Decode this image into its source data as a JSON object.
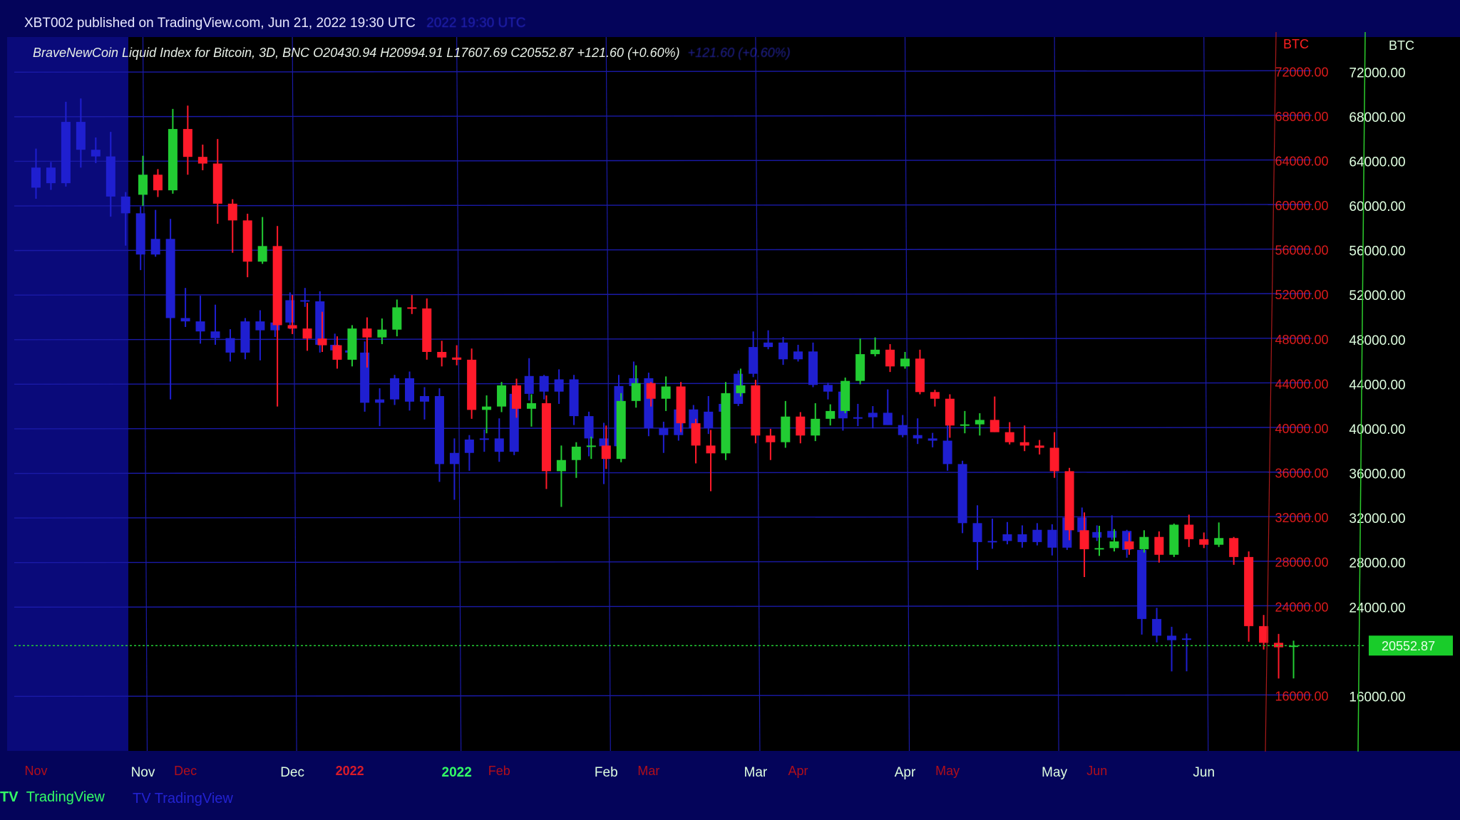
{
  "header": {
    "publish_line": "XBT002 published on TradingView.com, Jun 21, 2022 19:30 UTC",
    "ghost_publish_time": "2022 19:30 UTC",
    "symbol_line": "BraveNewCoin Liquid Index for Bitcoin, 3D, BNC  O20430.94  H20994.91  L17607.69  C20552.87  +121.60 (+0.60%)",
    "ghost_change": "+121.60 (+0.60%)"
  },
  "footer": {
    "brand": "TradingView",
    "logo": "TV"
  },
  "colors": {
    "background": "#000000",
    "frame": "#04045a",
    "up": "#22cc33",
    "down": "#ff1a2a",
    "ghost": "#1f1fd0",
    "grid": "#1a1aa8",
    "axis_text_green": "#dfffe0",
    "axis_text_red": "#ff2020",
    "last_price_bg": "#19cc2a"
  },
  "chart_data": {
    "type": "candlestick",
    "title": "BraveNewCoin Liquid Index for Bitcoin, 3D, BNC",
    "ylabel": "BTC",
    "ylim": [
      12000,
      74000
    ],
    "y_ticks": [
      "72000.00",
      "68000.00",
      "64000.00",
      "60000.00",
      "56000.00",
      "52000.00",
      "48000.00",
      "44000.00",
      "40000.00",
      "36000.00",
      "32000.00",
      "28000.00",
      "24000.00",
      "16000.00"
    ],
    "x_ticks": [
      "Nov",
      "Dec",
      "2022",
      "Feb",
      "Mar",
      "Apr",
      "May",
      "Jun"
    ],
    "last_price": "20552.87",
    "last_candle": {
      "open": 20430.94,
      "high": 20994.91,
      "low": 17607.69,
      "close": 20552.87,
      "change": "+121.60 (+0.60%)"
    },
    "candles": [
      {
        "date": "2021-11-01",
        "o": 61000,
        "h": 64500,
        "l": 60000,
        "c": 62800
      },
      {
        "date": "2021-11-04",
        "o": 62800,
        "h": 63300,
        "l": 60800,
        "c": 61400
      },
      {
        "date": "2021-11-07",
        "o": 61400,
        "h": 68700,
        "l": 61100,
        "c": 66900
      },
      {
        "date": "2021-11-10",
        "o": 66900,
        "h": 69000,
        "l": 62800,
        "c": 64400
      },
      {
        "date": "2021-11-13",
        "o": 64400,
        "h": 65500,
        "l": 63200,
        "c": 63800
      },
      {
        "date": "2021-11-16",
        "o": 63800,
        "h": 66000,
        "l": 58400,
        "c": 60200
      },
      {
        "date": "2021-11-19",
        "o": 60200,
        "h": 60600,
        "l": 55800,
        "c": 58700
      },
      {
        "date": "2021-11-22",
        "o": 58700,
        "h": 59300,
        "l": 53600,
        "c": 55000
      },
      {
        "date": "2021-11-25",
        "o": 55000,
        "h": 59000,
        "l": 54800,
        "c": 56400
      },
      {
        "date": "2021-11-28",
        "o": 56400,
        "h": 58200,
        "l": 42000,
        "c": 49300
      },
      {
        "date": "2021-12-01",
        "o": 49300,
        "h": 52000,
        "l": 48500,
        "c": 49000
      },
      {
        "date": "2021-12-04",
        "o": 49000,
        "h": 51300,
        "l": 47000,
        "c": 48100
      },
      {
        "date": "2021-12-07",
        "o": 48100,
        "h": 50500,
        "l": 46900,
        "c": 47500
      },
      {
        "date": "2021-12-10",
        "o": 47500,
        "h": 48300,
        "l": 45400,
        "c": 46200
      },
      {
        "date": "2021-12-13",
        "o": 46200,
        "h": 49300,
        "l": 45600,
        "c": 49000
      },
      {
        "date": "2021-12-16",
        "o": 49000,
        "h": 50000,
        "l": 45500,
        "c": 48200
      },
      {
        "date": "2021-12-19",
        "o": 48200,
        "h": 49900,
        "l": 47600,
        "c": 48900
      },
      {
        "date": "2021-12-22",
        "o": 48900,
        "h": 51600,
        "l": 48300,
        "c": 50900
      },
      {
        "date": "2021-12-25",
        "o": 50900,
        "h": 52000,
        "l": 50300,
        "c": 50800
      },
      {
        "date": "2021-12-28",
        "o": 50800,
        "h": 51700,
        "l": 46200,
        "c": 46900
      },
      {
        "date": "2021-12-31",
        "o": 46900,
        "h": 47900,
        "l": 45600,
        "c": 46400
      },
      {
        "date": "2022-01-03",
        "o": 46400,
        "h": 47500,
        "l": 45700,
        "c": 46200
      },
      {
        "date": "2022-01-06",
        "o": 46200,
        "h": 47200,
        "l": 40900,
        "c": 41700
      },
      {
        "date": "2022-01-09",
        "o": 41700,
        "h": 43000,
        "l": 39600,
        "c": 42000
      },
      {
        "date": "2022-01-12",
        "o": 42000,
        "h": 44200,
        "l": 41500,
        "c": 43900
      },
      {
        "date": "2022-01-15",
        "o": 43900,
        "h": 44500,
        "l": 41000,
        "c": 41800
      },
      {
        "date": "2022-01-18",
        "o": 41800,
        "h": 43100,
        "l": 40200,
        "c": 42300
      },
      {
        "date": "2022-01-21",
        "o": 42300,
        "h": 43000,
        "l": 34600,
        "c": 36200
      },
      {
        "date": "2022-01-24",
        "o": 36200,
        "h": 38500,
        "l": 33000,
        "c": 37200
      },
      {
        "date": "2022-01-27",
        "o": 37200,
        "h": 38800,
        "l": 35600,
        "c": 38400
      },
      {
        "date": "2022-01-30",
        "o": 38400,
        "h": 39300,
        "l": 37300,
        "c": 38500
      },
      {
        "date": "2022-02-02",
        "o": 38500,
        "h": 40300,
        "l": 36400,
        "c": 37300
      },
      {
        "date": "2022-02-05",
        "o": 37300,
        "h": 43200,
        "l": 37000,
        "c": 42500
      },
      {
        "date": "2022-02-08",
        "o": 42500,
        "h": 45700,
        "l": 41900,
        "c": 44100
      },
      {
        "date": "2022-02-11",
        "o": 44100,
        "h": 44200,
        "l": 42000,
        "c": 42700
      },
      {
        "date": "2022-02-14",
        "o": 42700,
        "h": 44700,
        "l": 41600,
        "c": 43800
      },
      {
        "date": "2022-02-17",
        "o": 43800,
        "h": 44200,
        "l": 39700,
        "c": 40500
      },
      {
        "date": "2022-02-20",
        "o": 40500,
        "h": 40900,
        "l": 36900,
        "c": 38500
      },
      {
        "date": "2022-02-23",
        "o": 38500,
        "h": 39900,
        "l": 34400,
        "c": 37800
      },
      {
        "date": "2022-02-26",
        "o": 37800,
        "h": 44200,
        "l": 37200,
        "c": 43200
      },
      {
        "date": "2022-03-01",
        "o": 43200,
        "h": 45400,
        "l": 42900,
        "c": 43900
      },
      {
        "date": "2022-03-04",
        "o": 43900,
        "h": 44400,
        "l": 38700,
        "c": 39400
      },
      {
        "date": "2022-03-07",
        "o": 39400,
        "h": 40000,
        "l": 37200,
        "c": 38800
      },
      {
        "date": "2022-03-10",
        "o": 38800,
        "h": 42500,
        "l": 38300,
        "c": 41100
      },
      {
        "date": "2022-03-13",
        "o": 41100,
        "h": 41500,
        "l": 38700,
        "c": 39400
      },
      {
        "date": "2022-03-16",
        "o": 39400,
        "h": 42300,
        "l": 38900,
        "c": 40900
      },
      {
        "date": "2022-03-19",
        "o": 40900,
        "h": 42200,
        "l": 40300,
        "c": 41600
      },
      {
        "date": "2022-03-22",
        "o": 41600,
        "h": 44600,
        "l": 41400,
        "c": 44300
      },
      {
        "date": "2022-03-25",
        "o": 44300,
        "h": 48100,
        "l": 44000,
        "c": 46700
      },
      {
        "date": "2022-03-28",
        "o": 46700,
        "h": 48200,
        "l": 46500,
        "c": 47100
      },
      {
        "date": "2022-03-31",
        "o": 47100,
        "h": 47600,
        "l": 45100,
        "c": 45600
      },
      {
        "date": "2022-04-03",
        "o": 45600,
        "h": 46900,
        "l": 45400,
        "c": 46300
      },
      {
        "date": "2022-04-06",
        "o": 46300,
        "h": 47100,
        "l": 43100,
        "c": 43300
      },
      {
        "date": "2022-04-09",
        "o": 43300,
        "h": 43500,
        "l": 42000,
        "c": 42700
      },
      {
        "date": "2022-04-12",
        "o": 42700,
        "h": 43100,
        "l": 39200,
        "c": 40300
      },
      {
        "date": "2022-04-15",
        "o": 40300,
        "h": 41600,
        "l": 39600,
        "c": 40400
      },
      {
        "date": "2022-04-18",
        "o": 40400,
        "h": 41400,
        "l": 39400,
        "c": 40800
      },
      {
        "date": "2022-04-21",
        "o": 40800,
        "h": 42900,
        "l": 39700,
        "c": 39700
      },
      {
        "date": "2022-04-24",
        "o": 39700,
        "h": 40600,
        "l": 38600,
        "c": 38800
      },
      {
        "date": "2022-04-27",
        "o": 38800,
        "h": 40300,
        "l": 38000,
        "c": 38500
      },
      {
        "date": "2022-04-30",
        "o": 38500,
        "h": 39000,
        "l": 37700,
        "c": 38300
      },
      {
        "date": "2022-05-03",
        "o": 38300,
        "h": 39700,
        "l": 35600,
        "c": 36200
      },
      {
        "date": "2022-05-06",
        "o": 36200,
        "h": 36500,
        "l": 30000,
        "c": 30900
      },
      {
        "date": "2022-05-09",
        "o": 30900,
        "h": 32500,
        "l": 26700,
        "c": 29200
      },
      {
        "date": "2022-05-12",
        "o": 29200,
        "h": 31300,
        "l": 28600,
        "c": 29300
      },
      {
        "date": "2022-05-15",
        "o": 29300,
        "h": 31000,
        "l": 29000,
        "c": 29900
      },
      {
        "date": "2022-05-18",
        "o": 29900,
        "h": 30700,
        "l": 28700,
        "c": 29200
      },
      {
        "date": "2022-05-21",
        "o": 29200,
        "h": 30900,
        "l": 28900,
        "c": 30300
      },
      {
        "date": "2022-05-24",
        "o": 30300,
        "h": 30800,
        "l": 28000,
        "c": 28700
      },
      {
        "date": "2022-05-27",
        "o": 28700,
        "h": 31500,
        "l": 28500,
        "c": 31400
      },
      {
        "date": "2022-05-30",
        "o": 31400,
        "h": 32300,
        "l": 29400,
        "c": 30100
      },
      {
        "date": "2022-06-02",
        "o": 30100,
        "h": 30700,
        "l": 29300,
        "c": 29600
      },
      {
        "date": "2022-06-05",
        "o": 29600,
        "h": 31600,
        "l": 29400,
        "c": 30200
      },
      {
        "date": "2022-06-08",
        "o": 30200,
        "h": 30300,
        "l": 27800,
        "c": 28500
      },
      {
        "date": "2022-06-11",
        "o": 28500,
        "h": 29000,
        "l": 20900,
        "c": 22300
      },
      {
        "date": "2022-06-14",
        "o": 22300,
        "h": 23300,
        "l": 20200,
        "c": 20800
      },
      {
        "date": "2022-06-17",
        "o": 20800,
        "h": 21600,
        "l": 17600,
        "c": 20400
      },
      {
        "date": "2022-06-20",
        "o": 20430.94,
        "h": 20994.91,
        "l": 17607.69,
        "c": 20552.87
      }
    ]
  }
}
